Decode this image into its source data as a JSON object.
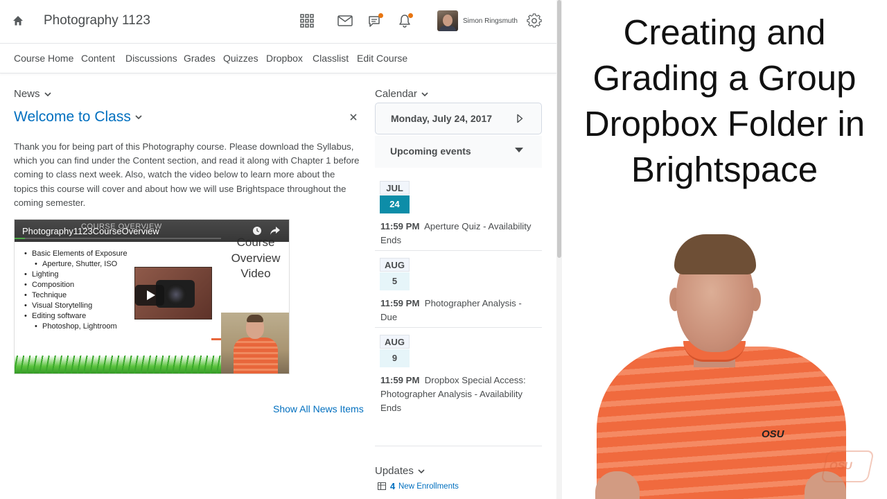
{
  "header": {
    "course_title": "Photography 1123",
    "user_name": "Simon Ringsmuth"
  },
  "nav": {
    "items": [
      "Course Home",
      "Content",
      "Discussions",
      "Grades",
      "Quizzes",
      "Dropbox",
      "Classlist",
      "Edit Course"
    ]
  },
  "news": {
    "label": "News",
    "item_title": "Welcome to Class",
    "body": "Thank you for being part of this Photography course. Please download the Syllabus, which you can find under the Content section, and read it along with Chapter 1 before coming to class next week. Also, watch the video below to learn more about the topics this course will cover and about how we will use Brightspace throughout the coming semester.",
    "show_all": "Show All News Items"
  },
  "video": {
    "title": "Photography1123CourseOverview",
    "ghost_title": "COURSE OVERVIEW",
    "heading": "Course Overview Video",
    "bullets": [
      "Basic Elements of Exposure",
      "Aperture, Shutter, ISO",
      "Lighting",
      "Composition",
      "Technique",
      "Visual Storytelling",
      "Editing software",
      "Photoshop, Lightroom"
    ],
    "progress": 0.05
  },
  "calendar": {
    "label": "Calendar",
    "date": "Monday, July 24, 2017",
    "upcoming_label": "Upcoming events",
    "events": [
      {
        "month": "JUL",
        "day": "24",
        "time": "11:59 PM",
        "title": "Aperture Quiz - Availability Ends",
        "today": true
      },
      {
        "month": "AUG",
        "day": "5",
        "time": "11:59 PM",
        "title": "Photographer Analysis - Due",
        "today": false
      },
      {
        "month": "AUG",
        "day": "9",
        "time": "11:59 PM",
        "title": "Dropbox Special Access: Photographer Analysis - Availability Ends",
        "today": false
      }
    ]
  },
  "updates": {
    "label": "Updates",
    "count": "4",
    "text": "New Enrollments"
  },
  "overlay": {
    "title": "Creating and Grading a Group Dropbox Folder in Brightspace",
    "shirt_logo": "OSU",
    "watermark": "OSU"
  },
  "colors": {
    "link": "#006fbf",
    "today_badge": "#0d8da8",
    "day_badge": "#e6f5f9",
    "notification_dot": "#e87511",
    "text": "#494c4e"
  },
  "icons": {
    "home": "home-icon",
    "apps": "waffle-grid-icon",
    "mail": "envelope-icon",
    "chat": "chat-bubble-icon",
    "alerts": "bell-icon",
    "settings": "gear-icon"
  }
}
